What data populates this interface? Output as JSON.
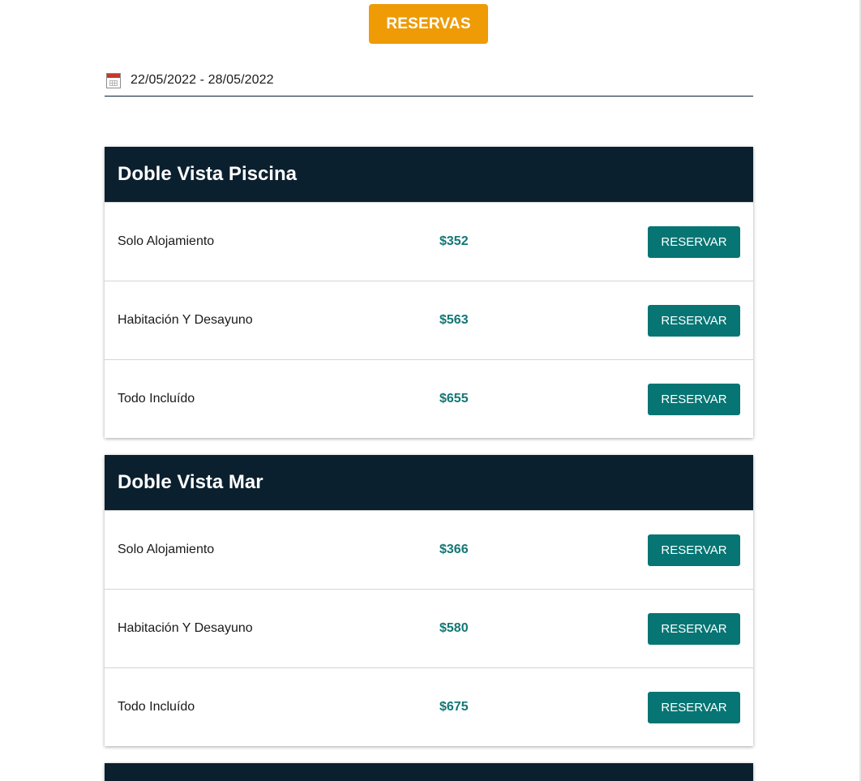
{
  "header": {
    "reservas_label": "RESERVAS"
  },
  "date_range": {
    "value": "22/05/2022 - 28/05/2022",
    "icon": "calendar-icon"
  },
  "colors": {
    "accent_orange": "#ee9b06",
    "header_dark": "#0b202e",
    "teal_button": "#067573",
    "teal_price": "#127774"
  },
  "rooms": [
    {
      "title": "Doble Vista Piscina",
      "options": [
        {
          "plan": "Solo Alojamiento",
          "price": "$352",
          "button": "RESERVAR"
        },
        {
          "plan": "Habitación Y Desayuno",
          "price": "$563",
          "button": "RESERVAR"
        },
        {
          "plan": "Todo Incluído",
          "price": "$655",
          "button": "RESERVAR"
        }
      ]
    },
    {
      "title": "Doble Vista Mar",
      "options": [
        {
          "plan": "Solo Alojamiento",
          "price": "$366",
          "button": "RESERVAR"
        },
        {
          "plan": "Habitación Y Desayuno",
          "price": "$580",
          "button": "RESERVAR"
        },
        {
          "plan": "Todo Incluído",
          "price": "$675",
          "button": "RESERVAR"
        }
      ]
    }
  ]
}
